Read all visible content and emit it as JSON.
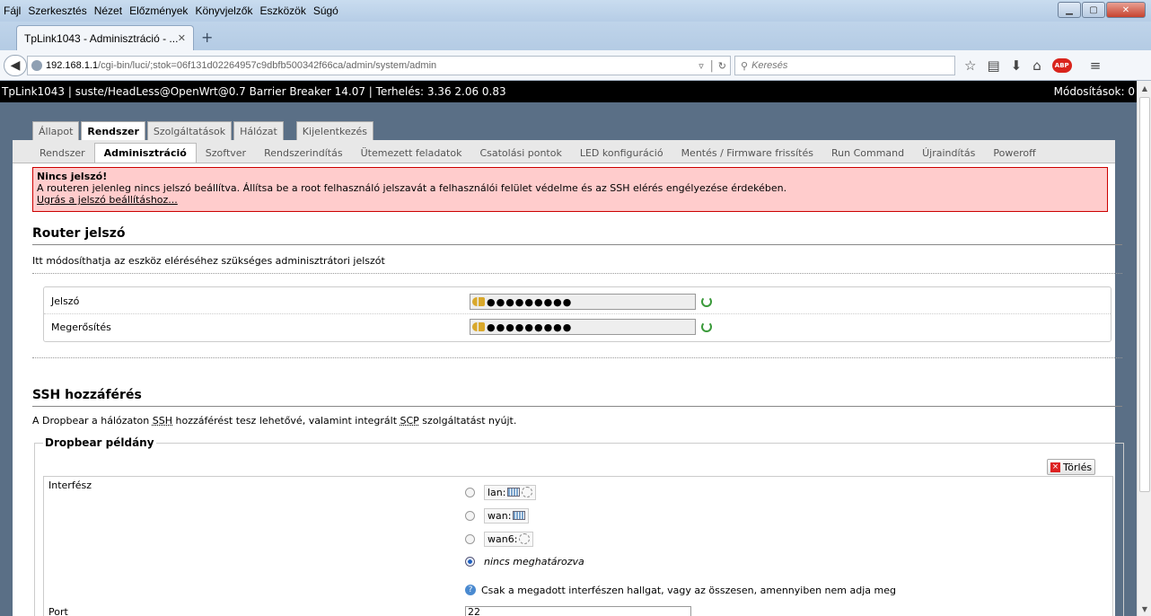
{
  "menubar": {
    "items": [
      "Fájl",
      "Szerkesztés",
      "Nézet",
      "Előzmények",
      "Könyvjelzők",
      "Eszközök",
      "Súgó"
    ]
  },
  "browser": {
    "tab_title": "TpLink1043 - Adminisztráció - ...",
    "url_host": "192.168.1.1",
    "url_path": "/cgi-bin/luci/;stok=06f131d02264957c9dbfb500342f66ca/admin/system/admin",
    "search_placeholder": "Keresés",
    "abp_label": "ABP"
  },
  "header": {
    "info": "TpLink1043 | suste/HeadLess@OpenWrt@0.7 Barrier Breaker 14.07 | Terhelés: 3.36 2.06 0.83",
    "changes": "Módosítások: 0"
  },
  "main_tabs": [
    "Állapot",
    "Rendszer",
    "Szolgáltatások",
    "Hálózat",
    "Kijelentkezés"
  ],
  "sub_tabs": [
    "Rendszer",
    "Adminisztráció",
    "Szoftver",
    "Rendszerindítás",
    "Ütemezett feladatok",
    "Csatolási pontok",
    "LED konfiguráció",
    "Mentés / Firmware frissítés",
    "Run Command",
    "Újraindítás",
    "Poweroff"
  ],
  "alert": {
    "title": "Nincs jelszó!",
    "text": "A routeren jelenleg nincs jelszó beállítva. Állítsa be a root felhasználó jelszavát a felhasználói felület védelme és az SSH elérés engélyezése érdekében.",
    "link": "Ugrás a jelszó beállításhoz..."
  },
  "router_password": {
    "title": "Router jelszó",
    "desc": "Itt módosíthatja az eszköz eléréséhez szükséges adminisztrátori jelszót",
    "password_label": "Jelszó",
    "password_value": "●●●●●●●●●",
    "confirm_label": "Megerősítés",
    "confirm_value": "●●●●●●●●●"
  },
  "ssh": {
    "title": "SSH hozzáférés",
    "desc_1": "A Dropbear a hálózaton ",
    "desc_ssh": "SSH",
    "desc_2": " hozzáférést tesz lehetővé, valamint integrált ",
    "desc_scp": "SCP",
    "desc_3": " szolgáltatást nyújt.",
    "legend": "Dropbear példány",
    "delete_label": "Törlés",
    "interface_label": "Interfész",
    "interfaces": [
      "lan:",
      "wan:",
      "wan6:"
    ],
    "unspecified": "nincs meghatározva",
    "hint": "Csak a megadott interfészen hallgat, vagy az összesen, amennyiben nem adja meg",
    "port_label": "Port",
    "port_value": "22"
  }
}
